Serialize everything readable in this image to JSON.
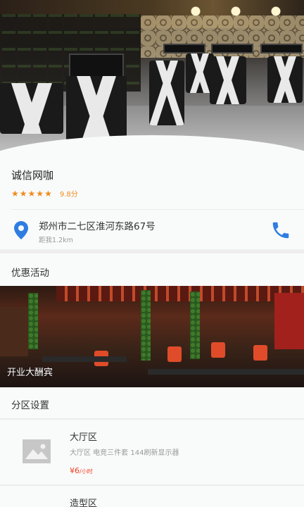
{
  "shop": {
    "name": "诚信网咖",
    "rating_stars": 5,
    "score": "9.8分",
    "address": "郑州市二七区淮河东路67号",
    "distance": "距我1.2km"
  },
  "sections": {
    "promotions_title": "优惠活动",
    "zones_title": "分区设置"
  },
  "promotion": {
    "caption": "开业大酬宾"
  },
  "zones": [
    {
      "name": "大厅区",
      "description": "大厅区 电竞三件套 144刷新显示器",
      "price_value": "¥6",
      "price_unit": "/小时"
    },
    {
      "name": "造型区"
    }
  ],
  "colors": {
    "accent_orange": "#f08a1c",
    "icon_blue": "#2f7de1",
    "price_red": "#f23c1e"
  },
  "icons": {
    "star": "star-icon",
    "location": "location-pin-icon",
    "phone": "phone-icon",
    "image_placeholder": "image-placeholder-icon"
  }
}
